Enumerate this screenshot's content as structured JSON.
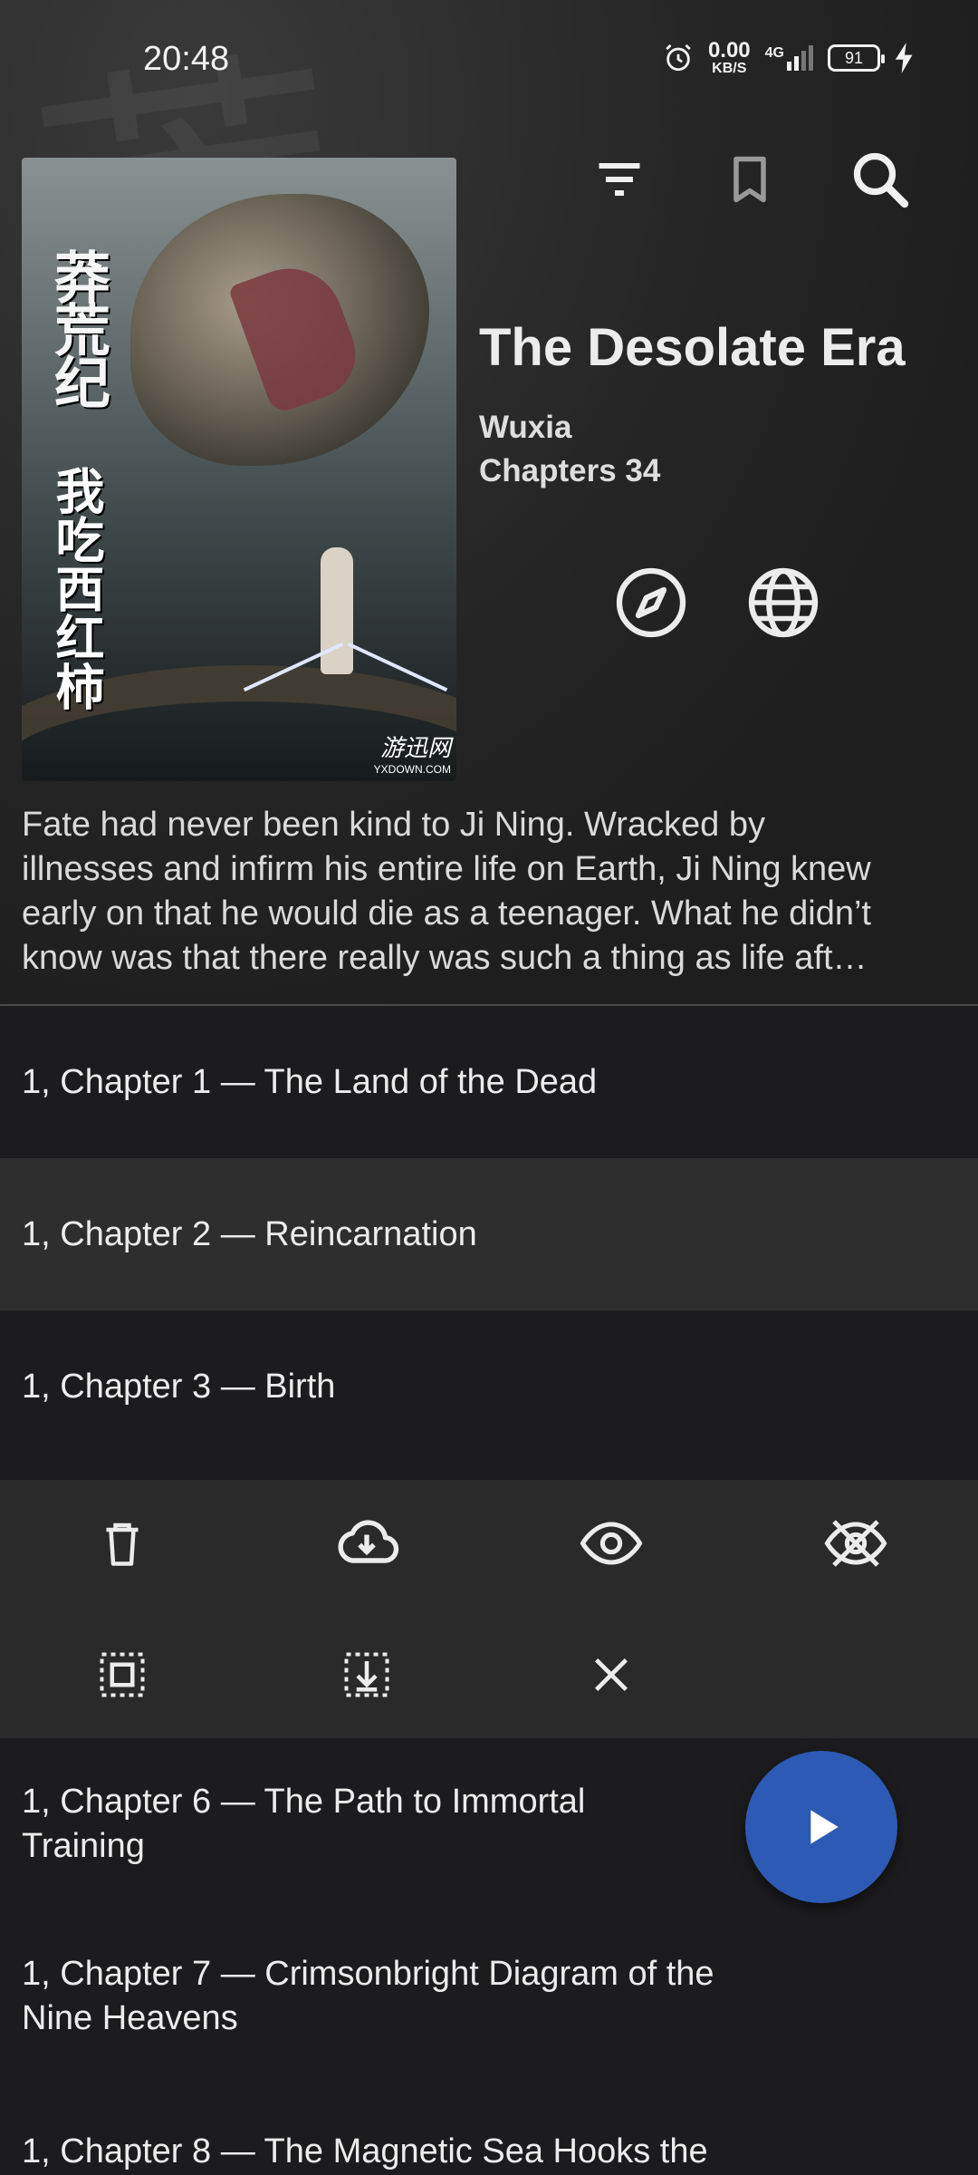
{
  "status_bar": {
    "time": "20:48",
    "net_speed_value": "0.00",
    "net_speed_unit": "KB/S",
    "network": "4G",
    "battery": "91"
  },
  "top_actions": {
    "icons": [
      "filter-icon",
      "bookmark-icon",
      "search-icon"
    ]
  },
  "book": {
    "title": "The Desolate Era",
    "genre": "Wuxia",
    "chapters": "Chapters 34",
    "cover_text": {
      "title_cn": "莽荒纪",
      "author_cn": "我吃西红柿",
      "publisher": "游迅网",
      "publisher_url": "YXDOWN.COM"
    },
    "description_lines": [
      "Fate had never been kind to Ji Ning. Wracked by",
      "illnesses and infirm his entire life on Earth, Ji Ning knew",
      "early on that he would die as a teenager. What he didn’t",
      "know was that there really was such a thing as life aft…"
    ]
  },
  "book_actions": {
    "icons": [
      "compass-icon",
      "globe-icon"
    ]
  },
  "chapters": [
    {
      "label": "1, Chapter 1 — The Land of the Dead",
      "selected": false
    },
    {
      "label": "1, Chapter 2 — Reincarnation",
      "selected": true
    },
    {
      "label": "1, Chapter 3 — Birth",
      "selected": false
    },
    {
      "label": "1, Chapter 6 — The Path to Immortal Training",
      "selected": false
    },
    {
      "label": "1, Chapter 7 — Crimsonbright Diagram of the Nine Heavens",
      "selected": false
    },
    {
      "label": "1, Chapter 8 — The Magnetic Sea Hooks the",
      "selected": false
    }
  ],
  "selection_actions": {
    "icons": [
      "delete-icon",
      "download-icon",
      "mark-read-icon",
      "mark-unread-icon",
      "select-all-icon",
      "select-below-icon",
      "close-icon"
    ]
  },
  "fab": {
    "icon": "play-icon"
  },
  "colors": {
    "background": "#1c1c1e",
    "panel": "#2a2a2b",
    "selected_row": "#2e2e2e",
    "fab": "#2c5ab5"
  }
}
